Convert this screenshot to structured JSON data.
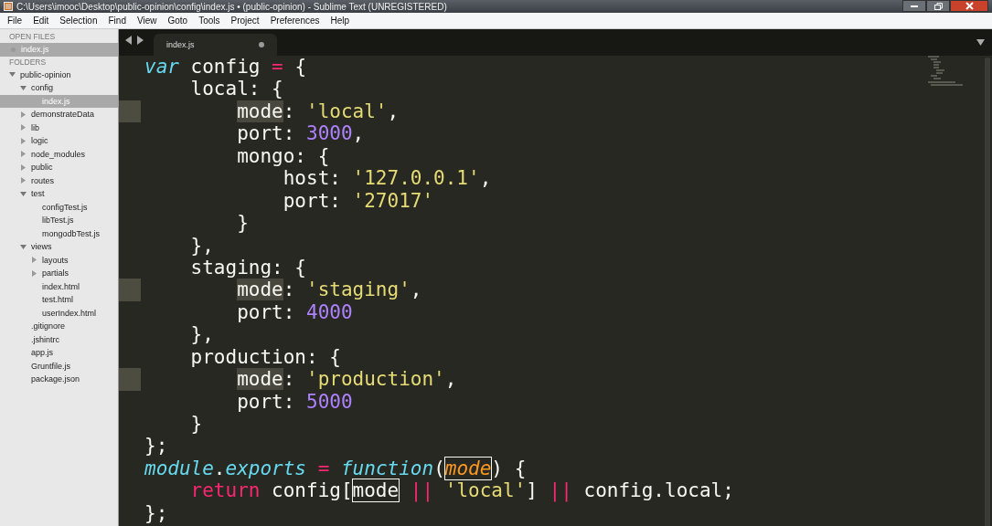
{
  "window": {
    "title": "C:\\Users\\imooc\\Desktop\\public-opinion\\config\\index.js • (public-opinion) - Sublime Text (UNREGISTERED)"
  },
  "menu": [
    "File",
    "Edit",
    "Selection",
    "Find",
    "View",
    "Goto",
    "Tools",
    "Project",
    "Preferences",
    "Help"
  ],
  "sidebar": {
    "open_files_header": "OPEN FILES",
    "open_files": [
      {
        "label": "index.js",
        "selected": true
      }
    ],
    "folders_header": "FOLDERS",
    "tree": [
      {
        "label": "public-opinion",
        "kind": "folder",
        "expanded": true,
        "selected": false,
        "children": [
          {
            "label": "config",
            "kind": "folder",
            "expanded": true,
            "selected": false,
            "children": [
              {
                "label": "index.js",
                "kind": "file",
                "selected": true
              }
            ]
          },
          {
            "label": "demonstrateData",
            "kind": "folder",
            "expanded": false,
            "selected": false
          },
          {
            "label": "lib",
            "kind": "folder",
            "expanded": false,
            "selected": false
          },
          {
            "label": "logic",
            "kind": "folder",
            "expanded": false,
            "selected": false
          },
          {
            "label": "node_modules",
            "kind": "folder",
            "expanded": false,
            "selected": false
          },
          {
            "label": "public",
            "kind": "folder",
            "expanded": false,
            "selected": false
          },
          {
            "label": "routes",
            "kind": "folder",
            "expanded": false,
            "selected": false
          },
          {
            "label": "test",
            "kind": "folder",
            "expanded": true,
            "selected": false,
            "children": [
              {
                "label": "configTest.js",
                "kind": "file",
                "selected": false
              },
              {
                "label": "libTest.js",
                "kind": "file",
                "selected": false
              },
              {
                "label": "mongodbTest.js",
                "kind": "file",
                "selected": false
              }
            ]
          },
          {
            "label": "views",
            "kind": "folder",
            "expanded": true,
            "selected": false,
            "children": [
              {
                "label": "layouts",
                "kind": "folder",
                "expanded": false,
                "selected": false
              },
              {
                "label": "partials",
                "kind": "folder",
                "expanded": false,
                "selected": false
              },
              {
                "label": "index.html",
                "kind": "file",
                "selected": false
              },
              {
                "label": "test.html",
                "kind": "file",
                "selected": false
              },
              {
                "label": "userIndex.html",
                "kind": "file",
                "selected": false
              }
            ]
          },
          {
            "label": ".gitignore",
            "kind": "file",
            "selected": false
          },
          {
            "label": ".jshintrc",
            "kind": "file",
            "selected": false
          },
          {
            "label": "app.js",
            "kind": "file",
            "selected": false
          },
          {
            "label": "Gruntfile.js",
            "kind": "file",
            "selected": false
          },
          {
            "label": "package.json",
            "kind": "file",
            "selected": false
          }
        ]
      }
    ]
  },
  "tabs": [
    {
      "label": "index.js",
      "selected": true,
      "modified": true
    }
  ],
  "code": [
    {
      "marked": false,
      "tokens": [
        {
          "text": "var",
          "kind": "storage"
        },
        {
          "text": " config ",
          "kind": "plain"
        },
        {
          "text": "=",
          "kind": "op"
        },
        {
          "text": " {",
          "kind": "plain"
        }
      ],
      "children": [
        {
          "marked": false,
          "tokens": [
            {
              "text": "local: {",
              "kind": "plain"
            }
          ],
          "children": [
            {
              "marked": true,
              "tokens": [
                {
                  "text": "mode",
                  "kind": "match"
                },
                {
                  "text": ": ",
                  "kind": "plain"
                },
                {
                  "text": "'local'",
                  "kind": "str"
                },
                {
                  "text": ",",
                  "kind": "plain"
                }
              ]
            },
            {
              "marked": false,
              "tokens": [
                {
                  "text": "port: ",
                  "kind": "plain"
                },
                {
                  "text": "3000",
                  "kind": "num"
                },
                {
                  "text": ",",
                  "kind": "plain"
                }
              ]
            },
            {
              "marked": false,
              "tokens": [
                {
                  "text": "mongo: {",
                  "kind": "plain"
                }
              ],
              "children": [
                {
                  "marked": false,
                  "tokens": [
                    {
                      "text": "host: ",
                      "kind": "plain"
                    },
                    {
                      "text": "'127.0.0.1'",
                      "kind": "str"
                    },
                    {
                      "text": ",",
                      "kind": "plain"
                    }
                  ]
                },
                {
                  "marked": false,
                  "tokens": [
                    {
                      "text": "port: ",
                      "kind": "plain"
                    },
                    {
                      "text": "'27017'",
                      "kind": "str"
                    }
                  ]
                }
              ]
            },
            {
              "marked": false,
              "tokens": [
                {
                  "text": "}",
                  "kind": "plain"
                }
              ]
            }
          ]
        },
        {
          "marked": false,
          "tokens": [
            {
              "text": "},",
              "kind": "plain"
            }
          ]
        },
        {
          "marked": false,
          "tokens": [
            {
              "text": "staging: {",
              "kind": "plain"
            }
          ],
          "children": [
            {
              "marked": true,
              "tokens": [
                {
                  "text": "mode",
                  "kind": "match"
                },
                {
                  "text": ": ",
                  "kind": "plain"
                },
                {
                  "text": "'staging'",
                  "kind": "str"
                },
                {
                  "text": ",",
                  "kind": "plain"
                }
              ]
            },
            {
              "marked": false,
              "tokens": [
                {
                  "text": "port: ",
                  "kind": "plain"
                },
                {
                  "text": "4000",
                  "kind": "num"
                }
              ]
            }
          ]
        },
        {
          "marked": false,
          "tokens": [
            {
              "text": "},",
              "kind": "plain"
            }
          ]
        },
        {
          "marked": false,
          "tokens": [
            {
              "text": "production: {",
              "kind": "plain"
            }
          ],
          "children": [
            {
              "marked": true,
              "tokens": [
                {
                  "text": "mode",
                  "kind": "match"
                },
                {
                  "text": ": ",
                  "kind": "plain"
                },
                {
                  "text": "'production'",
                  "kind": "str"
                },
                {
                  "text": ",",
                  "kind": "plain"
                }
              ]
            },
            {
              "marked": false,
              "tokens": [
                {
                  "text": "port: ",
                  "kind": "plain"
                },
                {
                  "text": "5000",
                  "kind": "num"
                }
              ]
            }
          ]
        },
        {
          "marked": false,
          "tokens": [
            {
              "text": "}",
              "kind": "plain"
            }
          ]
        }
      ]
    },
    {
      "marked": false,
      "tokens": [
        {
          "text": "};",
          "kind": "plain"
        }
      ]
    },
    {
      "marked": false,
      "tokens": [
        {
          "text": "module",
          "kind": "support"
        },
        {
          "text": ".",
          "kind": "plain"
        },
        {
          "text": "exports",
          "kind": "support"
        },
        {
          "text": " = ",
          "kind": "op"
        },
        {
          "text": "function",
          "kind": "storage"
        },
        {
          "text": "(",
          "kind": "plain"
        },
        {
          "text": "mode",
          "kind": "param"
        },
        {
          "text": ") {",
          "kind": "plain"
        }
      ],
      "children": [
        {
          "marked": false,
          "tokens": [
            {
              "text": "return",
              "kind": "op"
            },
            {
              "text": " config[",
              "kind": "plain"
            },
            {
              "text": "mode",
              "kind": "boxed"
            },
            {
              "text": " || ",
              "kind": "op"
            },
            {
              "text": "'local'",
              "kind": "str"
            },
            {
              "text": "] ",
              "kind": "plain"
            },
            {
              "text": "|| ",
              "kind": "op"
            },
            {
              "text": "config.local;",
              "kind": "plain"
            }
          ]
        }
      ]
    },
    {
      "marked": false,
      "tokens": [
        {
          "text": "};",
          "kind": "plain"
        }
      ]
    }
  ]
}
